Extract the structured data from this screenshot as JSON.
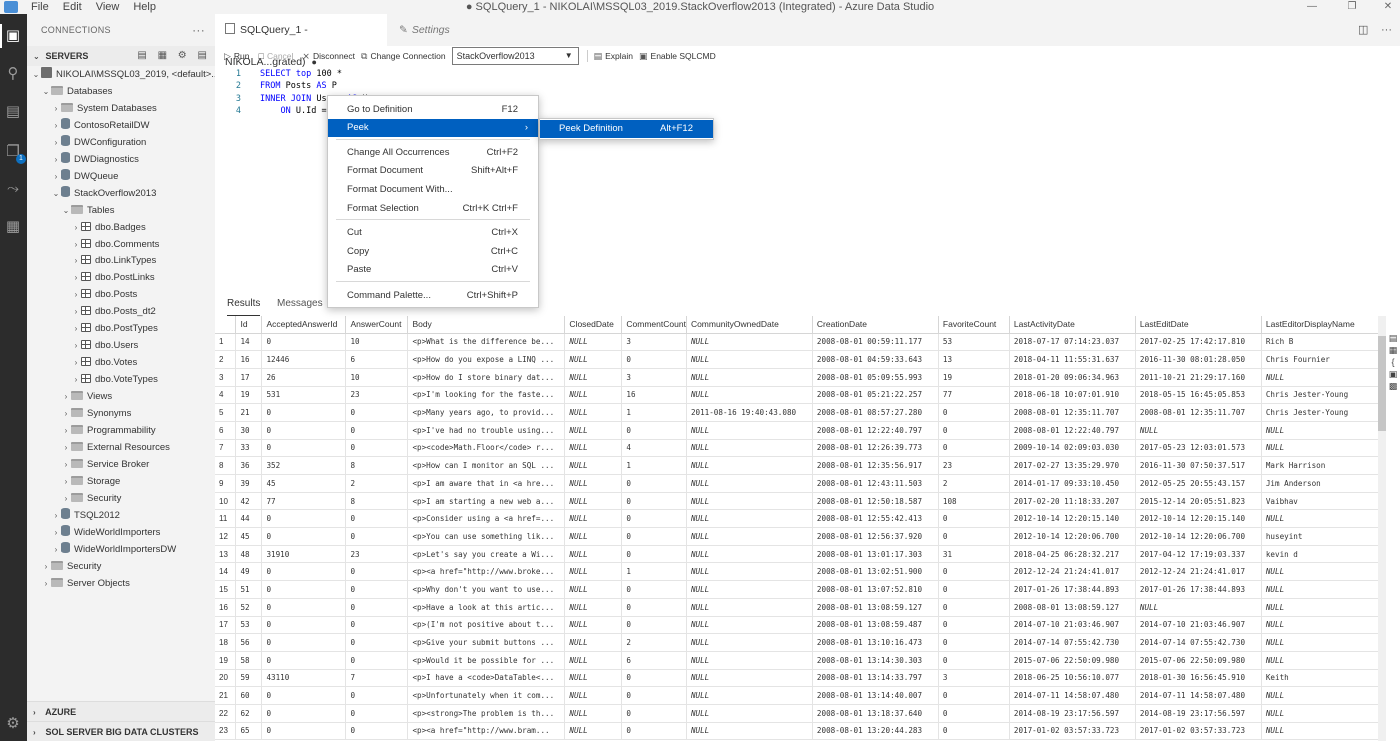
{
  "titlebar": {
    "menus": [
      "File",
      "Edit",
      "View",
      "Help"
    ],
    "title": "● SQLQuery_1 - NIKOLAI\\MSSQL03_2019.StackOverflow2013 (Integrated) - Azure Data Studio"
  },
  "sidebar": {
    "header": "CONNECTIONS",
    "servers_label": "SERVERS",
    "tree": [
      {
        "label": "NIKOLAI\\MSSQL03_2019, <default>...",
        "depth": 0,
        "chev": "⌄",
        "icon": "server"
      },
      {
        "label": "Databases",
        "depth": 1,
        "chev": "⌄",
        "icon": "folder"
      },
      {
        "label": "System Databases",
        "depth": 2,
        "chev": "›",
        "icon": "folder"
      },
      {
        "label": "ContosoRetailDW",
        "depth": 2,
        "chev": "›",
        "icon": "db"
      },
      {
        "label": "DWConfiguration",
        "depth": 2,
        "chev": "›",
        "icon": "db"
      },
      {
        "label": "DWDiagnostics",
        "depth": 2,
        "chev": "›",
        "icon": "db"
      },
      {
        "label": "DWQueue",
        "depth": 2,
        "chev": "›",
        "icon": "db"
      },
      {
        "label": "StackOverflow2013",
        "depth": 2,
        "chev": "⌄",
        "icon": "db"
      },
      {
        "label": "Tables",
        "depth": 3,
        "chev": "⌄",
        "icon": "folder"
      },
      {
        "label": "dbo.Badges",
        "depth": 4,
        "chev": "›",
        "icon": "table"
      },
      {
        "label": "dbo.Comments",
        "depth": 4,
        "chev": "›",
        "icon": "table"
      },
      {
        "label": "dbo.LinkTypes",
        "depth": 4,
        "chev": "›",
        "icon": "table"
      },
      {
        "label": "dbo.PostLinks",
        "depth": 4,
        "chev": "›",
        "icon": "table"
      },
      {
        "label": "dbo.Posts",
        "depth": 4,
        "chev": "›",
        "icon": "table"
      },
      {
        "label": "dbo.Posts_dt2",
        "depth": 4,
        "chev": "›",
        "icon": "table"
      },
      {
        "label": "dbo.PostTypes",
        "depth": 4,
        "chev": "›",
        "icon": "table"
      },
      {
        "label": "dbo.Users",
        "depth": 4,
        "chev": "›",
        "icon": "table"
      },
      {
        "label": "dbo.Votes",
        "depth": 4,
        "chev": "›",
        "icon": "table"
      },
      {
        "label": "dbo.VoteTypes",
        "depth": 4,
        "chev": "›",
        "icon": "table"
      },
      {
        "label": "Views",
        "depth": 3,
        "chev": "›",
        "icon": "folder"
      },
      {
        "label": "Synonyms",
        "depth": 3,
        "chev": "›",
        "icon": "folder"
      },
      {
        "label": "Programmability",
        "depth": 3,
        "chev": "›",
        "icon": "folder"
      },
      {
        "label": "External Resources",
        "depth": 3,
        "chev": "›",
        "icon": "folder"
      },
      {
        "label": "Service Broker",
        "depth": 3,
        "chev": "›",
        "icon": "folder"
      },
      {
        "label": "Storage",
        "depth": 3,
        "chev": "›",
        "icon": "folder"
      },
      {
        "label": "Security",
        "depth": 3,
        "chev": "›",
        "icon": "folder"
      },
      {
        "label": "TSQL2012",
        "depth": 2,
        "chev": "›",
        "icon": "db"
      },
      {
        "label": "WideWorldImporters",
        "depth": 2,
        "chev": "›",
        "icon": "db"
      },
      {
        "label": "WideWorldImportersDW",
        "depth": 2,
        "chev": "›",
        "icon": "db"
      },
      {
        "label": "Security",
        "depth": 1,
        "chev": "›",
        "icon": "folder"
      },
      {
        "label": "Server Objects",
        "depth": 1,
        "chev": "›",
        "icon": "folder"
      }
    ],
    "azure_label": "AZURE",
    "bigdata_label": "SOL SERVER BIG DATA CLUSTERS"
  },
  "tabs": {
    "active_label": "SQLQuery_1 - NIKOLA...grated)",
    "settings_label": "Settings"
  },
  "toolbar": {
    "run": "Run",
    "cancel": "Cancel",
    "disconnect": "Disconnect",
    "change_connection": "Change Connection",
    "database": "StackOverflow2013",
    "explain": "Explain",
    "enable_sqlcmd": "Enable SQLCMD"
  },
  "code": [
    {
      "n": "1",
      "text": "SELECT top 100 *"
    },
    {
      "n": "2",
      "text": "FROM Posts AS P"
    },
    {
      "n": "3",
      "text": "INNER JOIN Users AS U"
    },
    {
      "n": "4",
      "text": "    ON U.Id ="
    }
  ],
  "context_menu": {
    "items": [
      {
        "label": "Go to Definition",
        "kb": "F12"
      },
      {
        "label": "Peek",
        "kb": "",
        "submenu": true
      },
      {
        "label": "Change All Occurrences",
        "kb": "Ctrl+F2"
      },
      {
        "label": "Format Document",
        "kb": "Shift+Alt+F"
      },
      {
        "label": "Format Document With...",
        "kb": ""
      },
      {
        "label": "Format Selection",
        "kb": "Ctrl+K Ctrl+F"
      },
      {
        "label": "Cut",
        "kb": "Ctrl+X"
      },
      {
        "label": "Copy",
        "kb": "Ctrl+C"
      },
      {
        "label": "Paste",
        "kb": "Ctrl+V"
      },
      {
        "label": "Command Palette...",
        "kb": "Ctrl+Shift+P"
      }
    ],
    "submenu": {
      "label": "Peek Definition",
      "kb": "Alt+F12"
    }
  },
  "results": {
    "tab_results": "Results",
    "tab_messages": "Messages",
    "columns": [
      "Id",
      "AcceptedAnswerId",
      "AnswerCount",
      "Body",
      "ClosedDate",
      "CommentCount",
      "CommunityOwnedDate",
      "CreationDate",
      "FavoriteCount",
      "LastActivityDate",
      "LastEditDate",
      "LastEditorDisplayName"
    ],
    "rows": [
      [
        "1",
        "14",
        "0",
        "10",
        "<p>What is the difference be...",
        "NULL",
        "3",
        "NULL",
        "2008-08-01 00:59:11.177",
        "53",
        "2018-07-17 07:14:23.037",
        "2017-02-25 17:42:17.810",
        "Rich B"
      ],
      [
        "2",
        "16",
        "12446",
        "6",
        "<p>How do you expose a LINQ ...",
        "NULL",
        "0",
        "NULL",
        "2008-08-01 04:59:33.643",
        "13",
        "2018-04-11 11:55:31.637",
        "2016-11-30 08:01:28.050",
        "Chris Fournier"
      ],
      [
        "3",
        "17",
        "26",
        "10",
        "<p>How do I store binary dat...",
        "NULL",
        "3",
        "NULL",
        "2008-08-01 05:09:55.993",
        "19",
        "2018-01-20 09:06:34.963",
        "2011-10-21 21:29:17.160",
        "NULL"
      ],
      [
        "4",
        "19",
        "531",
        "23",
        "<p>I'm looking for the faste...",
        "NULL",
        "16",
        "NULL",
        "2008-08-01 05:21:22.257",
        "77",
        "2018-06-18 10:07:01.910",
        "2018-05-15 16:45:05.853",
        "Chris Jester-Young"
      ],
      [
        "5",
        "21",
        "0",
        "0",
        "<p>Many years ago, to provid...",
        "NULL",
        "1",
        "2011-08-16 19:40:43.080",
        "2008-08-01 08:57:27.280",
        "0",
        "2008-08-01 12:35:11.707",
        "2008-08-01 12:35:11.707",
        "Chris Jester-Young"
      ],
      [
        "6",
        "30",
        "0",
        "0",
        "<p>I've had no trouble using...",
        "NULL",
        "0",
        "NULL",
        "2008-08-01 12:22:40.797",
        "0",
        "2008-08-01 12:22:40.797",
        "NULL",
        "NULL"
      ],
      [
        "7",
        "33",
        "0",
        "0",
        "<p><code>Math.Floor</code> r...",
        "NULL",
        "4",
        "NULL",
        "2008-08-01 12:26:39.773",
        "0",
        "2009-10-14 02:09:03.030",
        "2017-05-23 12:03:01.573",
        "NULL"
      ],
      [
        "8",
        "36",
        "352",
        "8",
        "<p>How can I monitor an SQL ...",
        "NULL",
        "1",
        "NULL",
        "2008-08-01 12:35:56.917",
        "23",
        "2017-02-27 13:35:29.970",
        "2016-11-30 07:50:37.517",
        "Mark Harrison"
      ],
      [
        "9",
        "39",
        "45",
        "2",
        "<p>I am aware that in <a hre...",
        "NULL",
        "0",
        "NULL",
        "2008-08-01 12:43:11.503",
        "2",
        "2014-01-17 09:33:10.450",
        "2012-05-25 20:55:43.157",
        "Jim Anderson"
      ],
      [
        "10",
        "42",
        "77",
        "8",
        "<p>I am starting a new web a...",
        "NULL",
        "0",
        "NULL",
        "2008-08-01 12:50:18.587",
        "108",
        "2017-02-20 11:18:33.207",
        "2015-12-14 20:05:51.823",
        "Vaibhav"
      ],
      [
        "11",
        "44",
        "0",
        "0",
        "<p>Consider using a <a href=...",
        "NULL",
        "0",
        "NULL",
        "2008-08-01 12:55:42.413",
        "0",
        "2012-10-14 12:20:15.140",
        "2012-10-14 12:20:15.140",
        "NULL"
      ],
      [
        "12",
        "45",
        "0",
        "0",
        "<p>You can use something lik...",
        "NULL",
        "0",
        "NULL",
        "2008-08-01 12:56:37.920",
        "0",
        "2012-10-14 12:20:06.700",
        "2012-10-14 12:20:06.700",
        "huseyint"
      ],
      [
        "13",
        "48",
        "31910",
        "23",
        "<p>Let's say you create a Wi...",
        "NULL",
        "0",
        "NULL",
        "2008-08-01 13:01:17.303",
        "31",
        "2018-04-25 06:28:32.217",
        "2017-04-12 17:19:03.337",
        "kevin d"
      ],
      [
        "14",
        "49",
        "0",
        "0",
        "<p><a href=\"http://www.broke...",
        "NULL",
        "1",
        "NULL",
        "2008-08-01 13:02:51.900",
        "0",
        "2012-12-24 21:24:41.017",
        "2012-12-24 21:24:41.017",
        "NULL"
      ],
      [
        "15",
        "51",
        "0",
        "0",
        "<p>Why don't you want to use...",
        "NULL",
        "0",
        "NULL",
        "2008-08-01 13:07:52.810",
        "0",
        "2017-01-26 17:38:44.893",
        "2017-01-26 17:38:44.893",
        "NULL"
      ],
      [
        "16",
        "52",
        "0",
        "0",
        "<p>Have a look at this artic...",
        "NULL",
        "0",
        "NULL",
        "2008-08-01 13:08:59.127",
        "0",
        "2008-08-01 13:08:59.127",
        "NULL",
        "NULL"
      ],
      [
        "17",
        "53",
        "0",
        "0",
        "<p>(I'm not positive about t...",
        "NULL",
        "0",
        "NULL",
        "2008-08-01 13:08:59.487",
        "0",
        "2014-07-10 21:03:46.907",
        "2014-07-10 21:03:46.907",
        "NULL"
      ],
      [
        "18",
        "56",
        "0",
        "0",
        "<p>Give your submit buttons ...",
        "NULL",
        "2",
        "NULL",
        "2008-08-01 13:10:16.473",
        "0",
        "2014-07-14 07:55:42.730",
        "2014-07-14 07:55:42.730",
        "NULL"
      ],
      [
        "19",
        "58",
        "0",
        "0",
        "<p>Would it be possible for ...",
        "NULL",
        "6",
        "NULL",
        "2008-08-01 13:14:30.303",
        "0",
        "2015-07-06 22:50:09.980",
        "2015-07-06 22:50:09.980",
        "NULL"
      ],
      [
        "20",
        "59",
        "43110",
        "7",
        "<p>I have a <code>DataTable<...",
        "NULL",
        "0",
        "NULL",
        "2008-08-01 13:14:33.797",
        "3",
        "2018-06-25 10:56:10.077",
        "2018-01-30 16:56:45.910",
        "Keith"
      ],
      [
        "21",
        "60",
        "0",
        "0",
        "<p>Unfortunately when it com...",
        "NULL",
        "0",
        "NULL",
        "2008-08-01 13:14:40.007",
        "0",
        "2014-07-11 14:58:07.480",
        "2014-07-11 14:58:07.480",
        "NULL"
      ],
      [
        "22",
        "62",
        "0",
        "0",
        "<p><strong>The problem is th...",
        "NULL",
        "0",
        "NULL",
        "2008-08-01 13:18:37.640",
        "0",
        "2014-08-19 23:17:56.597",
        "2014-08-19 23:17:56.597",
        "NULL"
      ],
      [
        "23",
        "65",
        "0",
        "0",
        "<p><a href=\"http://www.bram...",
        "NULL",
        "0",
        "NULL",
        "2008-08-01 13:20:44.283",
        "0",
        "2017-01-02 03:57:33.723",
        "2017-01-02 03:57:33.723",
        "NULL"
      ]
    ]
  },
  "colors": {
    "accent": "#0060c0",
    "activitybar": "#2c2c2c",
    "keyword": "#0000ff"
  }
}
